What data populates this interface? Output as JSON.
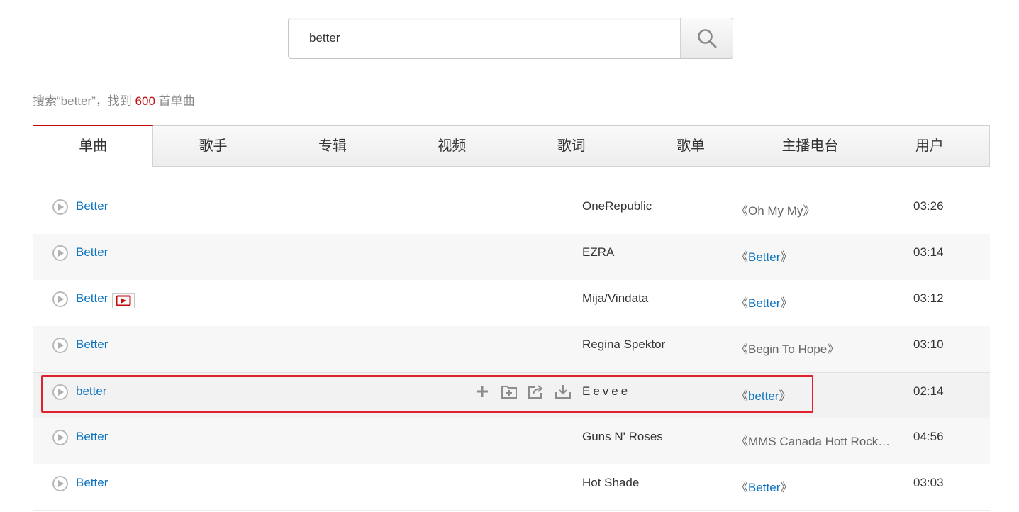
{
  "search": {
    "value": "better",
    "placeholder": ""
  },
  "summary": {
    "prefix": "搜索“better”，找到 ",
    "count": "600",
    "suffix": " 首单曲"
  },
  "tabs": [
    {
      "label": "单曲",
      "active": true
    },
    {
      "label": "歌手"
    },
    {
      "label": "专辑"
    },
    {
      "label": "视频"
    },
    {
      "label": "歌词"
    },
    {
      "label": "歌单"
    },
    {
      "label": "主播电台"
    },
    {
      "label": "用户"
    }
  ],
  "songs": [
    {
      "title": "Better",
      "artist": "OneRepublic",
      "album_open": "《",
      "album": "Oh My My",
      "album_close": "》",
      "album_link": false,
      "duration": "03:26"
    },
    {
      "title": "Better",
      "artist": "EZRA",
      "album_open": "《",
      "album": "Better",
      "album_close": "》",
      "album_link": true,
      "duration": "03:14"
    },
    {
      "title": "Better",
      "artist": "Mija/Vindata",
      "album_open": "《",
      "album": "Better",
      "album_close": "》",
      "album_link": true,
      "duration": "03:12",
      "mv": true
    },
    {
      "title": "Better",
      "artist": "Regina Spektor",
      "album_open": "《",
      "album": "Begin To Hope",
      "album_close": "》",
      "album_link": false,
      "duration": "03:10"
    },
    {
      "title": "better",
      "artist": "Eevee",
      "album_open": "《",
      "album": "better",
      "album_close": "》",
      "album_link": true,
      "duration": "02:14",
      "hover": true
    },
    {
      "title": "Better",
      "artist": "Guns N' Roses",
      "album_open": "《",
      "album": "MMS Canada Hott Rock…",
      "album_close": "",
      "album_link": false,
      "duration": "04:56"
    },
    {
      "title": "Better",
      "artist": "Hot Shade",
      "album_open": "《",
      "album": "Better",
      "album_close": "》",
      "album_link": true,
      "duration": "03:03"
    }
  ],
  "colors": {
    "accent": "#c20c0c",
    "link": "#0c73c2",
    "highlight": "#e0222e"
  },
  "icons": {
    "search": "search-icon",
    "play": "play-icon",
    "mv": "mv-icon",
    "add": "plus-icon",
    "collect": "folder-add-icon",
    "share": "share-icon",
    "download": "download-icon"
  }
}
